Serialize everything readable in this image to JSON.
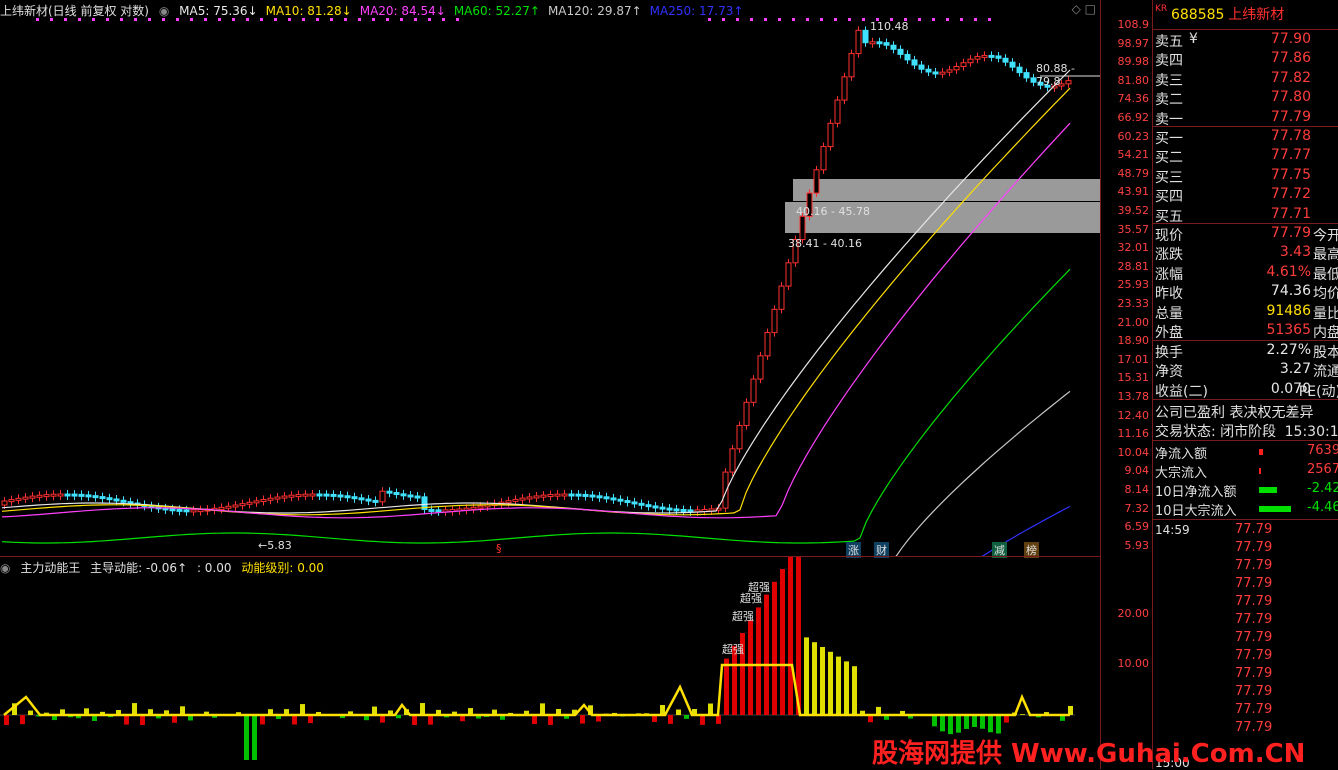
{
  "main_header": {
    "title": "上纬新材(日线 前复权 对数)",
    "ma": [
      {
        "label": "MA5: 75.36↓",
        "color": "#e8e8e8"
      },
      {
        "label": "MA10: 81.28↓",
        "color": "#ffe000"
      },
      {
        "label": "MA20: 84.54↓",
        "color": "#ff40ff"
      },
      {
        "label": "MA60: 52.27↑",
        "color": "#00e000"
      },
      {
        "label": "MA120: 29.87↑",
        "color": "#c8c8c8"
      },
      {
        "label": "MA250: 17.73↑",
        "color": "#3030ff"
      }
    ]
  },
  "price_axis": [
    "108.9",
    "98.97",
    "89.98",
    "81.80",
    "74.36",
    "66.92",
    "60.23",
    "54.21",
    "48.79",
    "43.91",
    "39.52",
    "35.57",
    "32.01",
    "28.81",
    "25.93",
    "23.33",
    "21.00",
    "18.90",
    "17.01",
    "15.31",
    "13.78",
    "12.40",
    "11.16",
    "10.04",
    "9.04",
    "8.14",
    "7.32",
    "6.59",
    "5.93"
  ],
  "chart_labels": {
    "high_label": "110.48",
    "low_label": "←5.83",
    "right_label": "80.88 - 79.8",
    "zone1": "40.16 - 45.78",
    "zone2": "38.41 - 40.16",
    "event_s": "§",
    "event_zhang": "涨",
    "event_cai": "财",
    "event_jian": "减",
    "event_bang": "榜"
  },
  "sub_header": {
    "title": "主力动能王",
    "f1": "主导动能: -0.06↑",
    "f2": ": 0.00",
    "f3": "动能级别: 0.00"
  },
  "sub_axis": [
    "20.00",
    "10.00"
  ],
  "sub_labels": {
    "strong": "超强"
  },
  "info": {
    "code": "688585",
    "name": "上纬新材",
    "kr": "KR",
    "asks": [
      {
        "k": "卖五",
        "v": "77.90",
        "mark": "¥"
      },
      {
        "k": "卖四",
        "v": "77.86"
      },
      {
        "k": "卖三",
        "v": "77.82"
      },
      {
        "k": "卖二",
        "v": "77.80"
      },
      {
        "k": "卖一",
        "v": "77.79"
      }
    ],
    "bids": [
      {
        "k": "买一",
        "v": "77.78"
      },
      {
        "k": "买二",
        "v": "77.77"
      },
      {
        "k": "买三",
        "v": "77.75"
      },
      {
        "k": "买四",
        "v": "77.72"
      },
      {
        "k": "买五",
        "v": "77.71"
      }
    ],
    "quote": [
      {
        "k": "现价",
        "v": "77.79",
        "k2": "今开",
        "c": "red"
      },
      {
        "k": "涨跌",
        "v": "3.43",
        "k2": "最高",
        "c": "red"
      },
      {
        "k": "涨幅",
        "v": "4.61%",
        "k2": "最低",
        "c": "red"
      },
      {
        "k": "昨收",
        "v": "74.36",
        "k2": "均价",
        "c": "white"
      },
      {
        "k": "总量",
        "v": "91486",
        "k2": "量比",
        "c": "yellow"
      },
      {
        "k": "外盘",
        "v": "51365",
        "k2": "内盘",
        "c": "red"
      }
    ],
    "quote2": [
      {
        "k": "换手",
        "v": "2.27%",
        "k2": "股本",
        "c": "white"
      },
      {
        "k": "净资",
        "v": "3.27",
        "k2": "流通",
        "c": "white"
      },
      {
        "k": "收益(二)",
        "v": "0.070",
        "k2": "PE(动)",
        "c": "white"
      }
    ],
    "status1": "公司已盈利 表决权无差异",
    "status2_k": "交易状态: 闭市阶段",
    "status2_t": "15:30:1",
    "flows": [
      {
        "k": "净流入额",
        "v": "7639",
        "c": "red",
        "bar": "#ff2020",
        "bw": 4
      },
      {
        "k": "大宗流入",
        "v": "2567",
        "c": "red",
        "bar": "#ff2020",
        "bw": 2
      },
      {
        "k": "10日净流入额",
        "v": "-2.42",
        "c": "green",
        "bar": "#00e000",
        "bw": 18
      },
      {
        "k": "10日大宗流入",
        "v": "-4.46",
        "c": "green",
        "bar": "#00e000",
        "bw": 32
      }
    ],
    "ticks_time": "14:59",
    "tick_price": "77.79",
    "tick_count": 12,
    "end_time": "15:00"
  },
  "watermark": "股海网提供 Www.Guhai.Com.CN"
}
